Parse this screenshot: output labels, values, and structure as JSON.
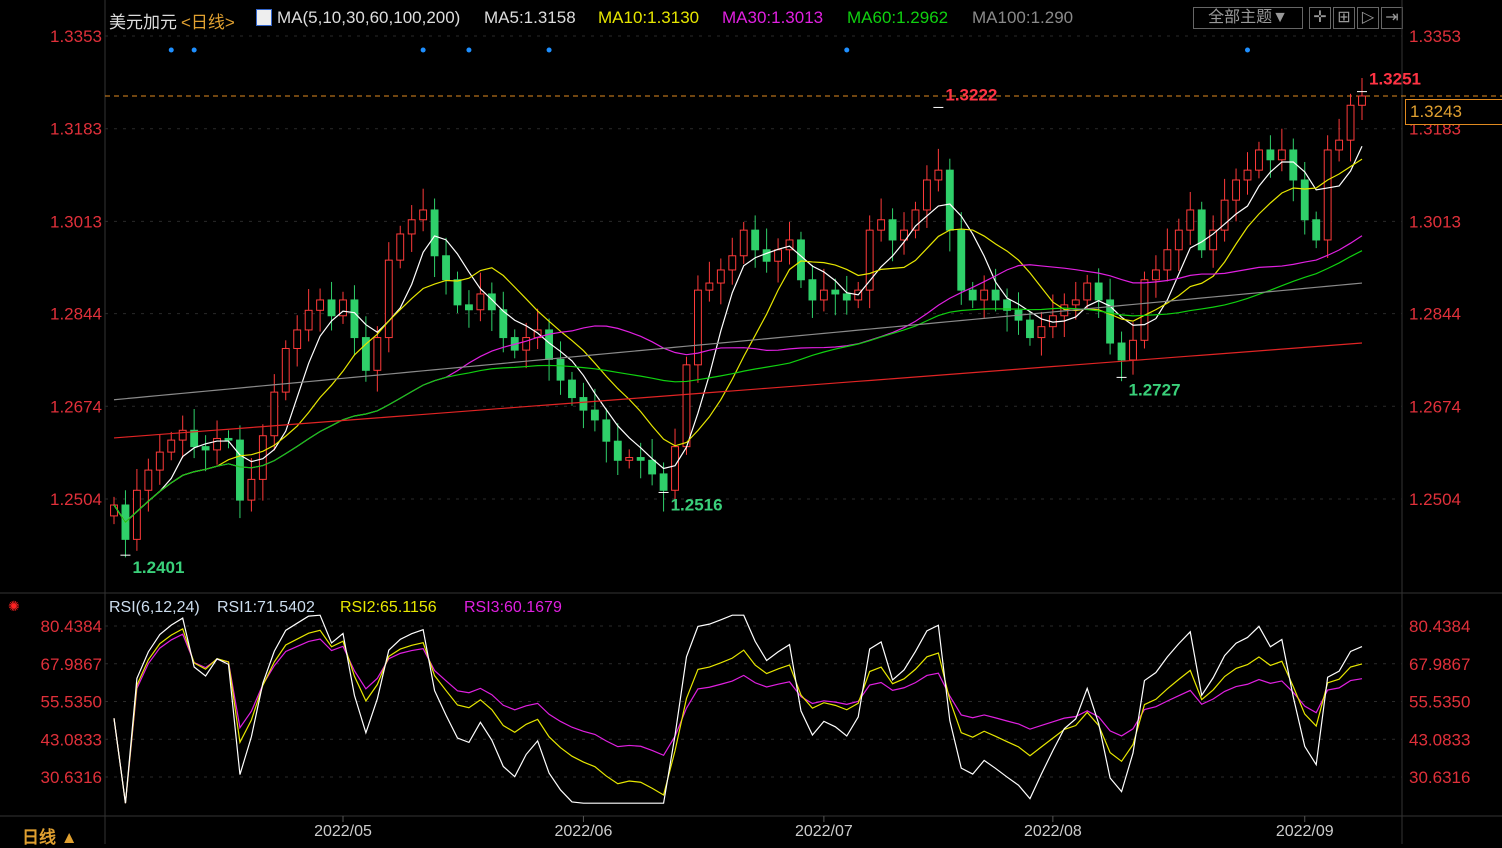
{
  "header": {
    "symbol": "美元加元",
    "period": "<日线>",
    "ma_label": "MA(5,10,30,60,100,200)",
    "ma5": "MA5:1.3158",
    "ma10": "MA10:1.3130",
    "ma30": "MA30:1.3013",
    "ma60": "MA60:1.2962",
    "ma100": "MA100:1.290",
    "theme_button": "全部主题▼",
    "tool_icons": [
      "crosshair-icon",
      "zoom-range-icon",
      "play-icon",
      "shift-right-icon"
    ]
  },
  "rsi_header": {
    "label": "RSI(6,12,24)",
    "rsi1": "RSI1:71.5402",
    "rsi2": "RSI2:65.1156",
    "rsi3": "RSI3:60.1679"
  },
  "footer": {
    "period_button": "日线 ▲"
  },
  "current_price": "1.3243",
  "colors": {
    "up": "#ff3a3a",
    "down": "#2fd06a",
    "ma5": "#ffffff",
    "ma10": "#e6e600",
    "ma30": "#e020e0",
    "ma60": "#10d010",
    "ma100": "#8a8a8a",
    "ma200": "#e02424"
  },
  "chart_data": {
    "type": "candlestick",
    "price_ticks": [
      "1.3353",
      "1.3183",
      "1.3013",
      "1.2844",
      "1.2674",
      "1.2504"
    ],
    "price_range": [
      1.2504,
      1.3353
    ],
    "rsi_ticks": [
      "80.4384",
      "67.9867",
      "55.5350",
      "43.0833",
      "30.6316"
    ],
    "rsi_range": [
      30.6316,
      80.4384
    ],
    "x_labels": [
      "2022/05",
      "2022/06",
      "2022/07",
      "2022/08",
      "2022/09"
    ],
    "x_label_index": [
      20,
      41,
      62,
      82,
      104
    ],
    "closes": [
      1.2493,
      1.243,
      1.252,
      1.2557,
      1.259,
      1.2612,
      1.263,
      1.26,
      1.2594,
      1.2615,
      1.2612,
      1.2502,
      1.254,
      1.262,
      1.27,
      1.278,
      1.2814,
      1.285,
      1.2869,
      1.284,
      1.2869,
      1.28,
      1.274,
      1.28,
      1.2942,
      1.299,
      1.3016,
      1.3034,
      1.295,
      1.2906,
      1.286,
      1.2851,
      1.288,
      1.2851,
      1.28,
      1.2777,
      1.28,
      1.2814,
      1.276,
      1.2722,
      1.269,
      1.2667,
      1.2649,
      1.261,
      1.2575,
      1.258,
      1.2575,
      1.255,
      1.252,
      1.26,
      1.275,
      1.2887,
      1.29,
      1.2924,
      1.295,
      1.2997,
      1.2961,
      1.294,
      1.2961,
      1.2979,
      1.2906,
      1.2869,
      1.2887,
      1.288,
      1.2869,
      1.2887,
      1.2997,
      1.3016,
      1.2979,
      1.2997,
      1.3034,
      1.3089,
      1.3107,
      1.2997,
      1.2887,
      1.2869,
      1.2887,
      1.2869,
      1.285,
      1.2832,
      1.28,
      1.282,
      1.284,
      1.286,
      1.2869,
      1.29,
      1.2869,
      1.279,
      1.2759,
      1.2795,
      1.2906,
      1.2924,
      1.2961,
      1.2997,
      1.3034,
      1.2961,
      1.2997,
      1.3052,
      1.3089,
      1.3107,
      1.3144,
      1.3126,
      1.3144,
      1.3089,
      1.3016,
      1.2979,
      1.3144,
      1.3162,
      1.3226,
      1.3243
    ],
    "ma100_range": [
      1.2686,
      1.29
    ],
    "ma200_range": [
      1.2616,
      1.279
    ],
    "annotations": [
      {
        "text": "1.2401",
        "index": 1,
        "price": 1.2401,
        "kind": "low"
      },
      {
        "text": "1.2516",
        "index": 48,
        "price": 1.2516,
        "kind": "low"
      },
      {
        "text": "1.3222",
        "index": 72,
        "price": 1.3222,
        "kind": "high"
      },
      {
        "text": "1.2727",
        "index": 88,
        "price": 1.2727,
        "kind": "low"
      },
      {
        "text": "1.3251",
        "index": 109,
        "price": 1.3251,
        "kind": "high"
      }
    ],
    "event_marker_index": [
      5,
      7,
      27,
      31,
      38,
      64,
      99
    ]
  }
}
